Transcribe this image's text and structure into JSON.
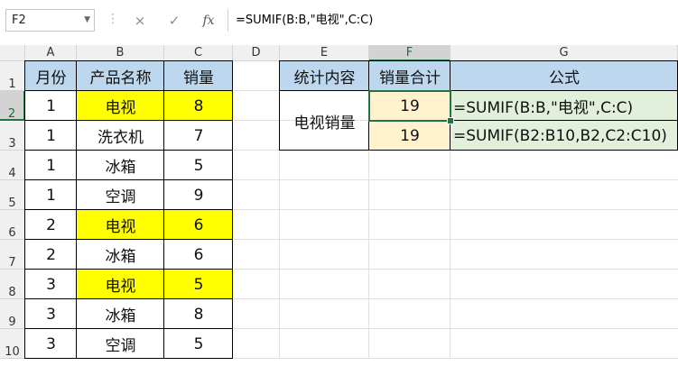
{
  "name_box": {
    "value": "F2"
  },
  "formula_bar": {
    "cancel_icon": "×",
    "enter_icon": "✓",
    "insert_function_label": "fx",
    "value": "=SUMIF(B:B,\"电视\",C:C)"
  },
  "columns": [
    "A",
    "B",
    "C",
    "D",
    "E",
    "F",
    "G"
  ],
  "rows": [
    "1",
    "2",
    "3",
    "4",
    "5",
    "6",
    "7",
    "8",
    "9",
    "10"
  ],
  "table_left": {
    "headers": [
      "月份",
      "产品名称",
      "销量"
    ],
    "rows": [
      [
        "1",
        "电视",
        "8"
      ],
      [
        "1",
        "洗衣机",
        "7"
      ],
      [
        "1",
        "冰箱",
        "5"
      ],
      [
        "1",
        "空调",
        "9"
      ],
      [
        "2",
        "电视",
        "6"
      ],
      [
        "2",
        "冰箱",
        "6"
      ],
      [
        "3",
        "电视",
        "5"
      ],
      [
        "3",
        "冰箱",
        "8"
      ],
      [
        "3",
        "空调",
        "5"
      ]
    ]
  },
  "table_right": {
    "headers": [
      "统计内容",
      "销量合计",
      "公式"
    ],
    "label": "电视销量",
    "results": [
      "19",
      "19"
    ],
    "formulas": [
      "=SUMIF(B:B,\"电视\",C:C)",
      "=SUMIF(B2:B10,B2,C2:C10)"
    ]
  },
  "colors": {
    "highlight_yellow": "#ffff00",
    "header_blue": "#bdd7ee",
    "result_peach": "#fff2cc",
    "formula_green": "#e2efda",
    "selection_green": "#217346"
  },
  "icons": {
    "namebox_dropdown": "chevron-down-icon",
    "cancel": "close-icon",
    "enter": "check-icon",
    "insert_function": "function-icon"
  }
}
